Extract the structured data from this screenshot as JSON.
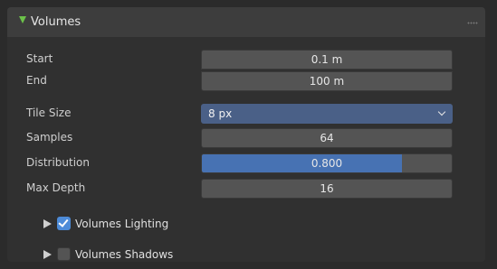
{
  "panel": {
    "title": "Volumes",
    "expanded": true
  },
  "properties": {
    "start": {
      "label": "Start",
      "value": "0.1 m"
    },
    "end": {
      "label": "End",
      "value": "100 m"
    },
    "tile_size": {
      "label": "Tile Size",
      "value": "8 px"
    },
    "samples": {
      "label": "Samples",
      "value": "64"
    },
    "distribution": {
      "label": "Distribution",
      "value": "0.800",
      "fill_fraction": 0.8
    },
    "max_depth": {
      "label": "Max Depth",
      "value": "16"
    }
  },
  "subpanels": [
    {
      "label": "Volumes Lighting",
      "checked": true
    },
    {
      "label": "Volumes Shadows",
      "checked": false
    }
  ],
  "colors": {
    "panel_header": "#3d3d3d",
    "panel_body": "#303030",
    "field": "#545454",
    "dropdown": "#4a6087",
    "slider_fill": "#4772b3",
    "checkbox_checked": "#4d8bd8",
    "expand_arrow": "#6cc24a"
  }
}
